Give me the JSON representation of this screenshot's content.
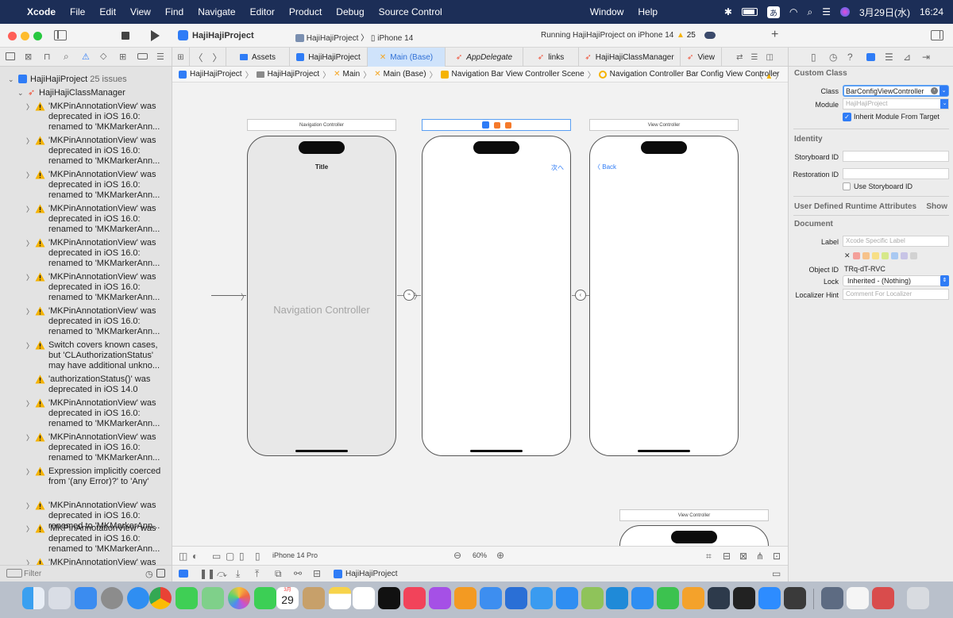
{
  "menubar": {
    "apple": "",
    "app": "Xcode",
    "items": [
      "File",
      "Edit",
      "View",
      "Find",
      "Navigate",
      "Editor",
      "Product",
      "Debug",
      "Source Control",
      "Window",
      "Help"
    ],
    "input_method": "あ",
    "date": "3月29日(水)",
    "time": "16:24"
  },
  "toolbar": {
    "project": "HajiHajiProject",
    "scheme": "HajiHajiProject",
    "device": "iPhone 14",
    "status": "Running HajiHajiProject on iPhone 14",
    "warnings": "25",
    "add": "+"
  },
  "navigator": {
    "project": "HajiHajiProject",
    "issue_count": "25 issues",
    "group": "HajiHajiClassManager",
    "issues": [
      "'MKPinAnnotationView' was deprecated in iOS 16.0: renamed to 'MKMarkerAnn...",
      "'MKPinAnnotationView' was deprecated in iOS 16.0: renamed to 'MKMarkerAnn...",
      "'MKPinAnnotationView' was deprecated in iOS 16.0: renamed to 'MKMarkerAnn...",
      "'MKPinAnnotationView' was deprecated in iOS 16.0: renamed to 'MKMarkerAnn...",
      "'MKPinAnnotationView' was deprecated in iOS 16.0: renamed to 'MKMarkerAnn...",
      "'MKPinAnnotationView' was deprecated in iOS 16.0: renamed to 'MKMarkerAnn...",
      "'MKPinAnnotationView' was deprecated in iOS 16.0: renamed to 'MKMarkerAnn...",
      "Switch covers known cases, but 'CLAuthorizationStatus' may have additional unkno...",
      "'authorizationStatus()' was deprecated in iOS 14.0",
      "'MKPinAnnotationView' was deprecated in iOS 16.0: renamed to 'MKMarkerAnn...",
      "'MKPinAnnotationView' was deprecated in iOS 16.0: renamed to 'MKMarkerAnn...",
      "Expression implicitly coerced from '(any Error)?' to 'Any'",
      "'MKPinAnnotationView' was deprecated in iOS 16.0: renamed to 'MKMarkerAnn...",
      "'MKPinAnnotationView' was deprecated in iOS 16.0: renamed to 'MKMarkerAnn...",
      "'MKPinAnnotationView' was"
    ],
    "filter_placeholder": "Filter"
  },
  "tabs": [
    "Assets",
    "HajiHajiProject",
    "Main (Base)",
    "AppDelegate",
    "links",
    "HajiHajiClassManager",
    "View"
  ],
  "breadcrumb": [
    "HajiHajiProject",
    "HajiHajiProject",
    "Main",
    "Main (Base)",
    "Navigation Bar View Controller Scene",
    "Navigation Controller Bar Config View Controller"
  ],
  "canvas": {
    "nav_controller_title": "Navigation Controller",
    "nav_bar_title": "Title",
    "nav_controller_label": "Navigation Controller",
    "next_button": "次へ",
    "view_controller_title": "View Controller",
    "back_button": "Back",
    "view_controller_title_2": "View Controller"
  },
  "canvas_bar": {
    "device": "iPhone 14 Pro",
    "zoom": "60%"
  },
  "debug_bar": {
    "target": "HajiHajiProject"
  },
  "inspector": {
    "custom_class_header": "Custom Class",
    "class_label": "Class",
    "class_value": "BarConfigViewController",
    "module_label": "Module",
    "module_placeholder": "HajiHajiProject",
    "inherit_label": "Inherit Module From Target",
    "identity_header": "Identity",
    "storyboard_id_label": "Storyboard ID",
    "restoration_id_label": "Restoration ID",
    "use_storyboard_id": "Use Storyboard ID",
    "runtime_header": "User Defined Runtime Attributes",
    "show": "Show",
    "document_header": "Document",
    "label_label": "Label",
    "label_placeholder": "Xcode Specific Label",
    "object_id_label": "Object ID",
    "object_id": "TRq-dT-RVC",
    "lock_label": "Lock",
    "lock_value": "Inherited - (Nothing)",
    "localizer_label": "Localizer Hint",
    "localizer_placeholder": "Comment For Localizer"
  },
  "dock": {
    "calendar_month": "3月",
    "calendar_day": "29"
  },
  "colors": {
    "menubar": "#1c2e57",
    "accent": "#2f7cf6",
    "warning": "#f5b300",
    "selected_tab": "#cfe3fb"
  }
}
